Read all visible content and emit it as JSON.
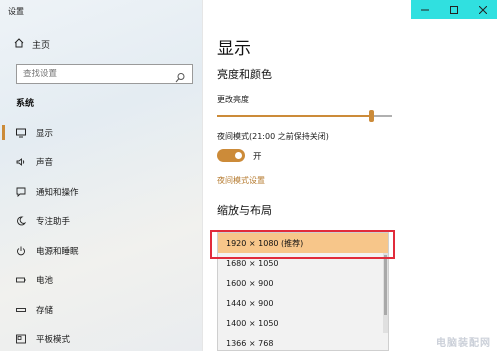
{
  "app": {
    "title": "设置"
  },
  "sidebar": {
    "home_label": "主页",
    "search_placeholder": "查找设置",
    "section_label": "系统",
    "items": [
      {
        "label": "显示",
        "icon": "monitor-icon",
        "active": true
      },
      {
        "label": "声音",
        "icon": "speaker-icon"
      },
      {
        "label": "通知和操作",
        "icon": "message-icon"
      },
      {
        "label": "专注助手",
        "icon": "moon-icon"
      },
      {
        "label": "电源和睡眠",
        "icon": "power-icon"
      },
      {
        "label": "电池",
        "icon": "battery-icon"
      },
      {
        "label": "存储",
        "icon": "storage-icon"
      },
      {
        "label": "平板模式",
        "icon": "tablet-icon"
      }
    ]
  },
  "window_controls": {
    "minimize": "—",
    "maximize": "☐",
    "close": "✕"
  },
  "main": {
    "title": "显示",
    "brightness_section": "亮度和颜色",
    "brightness_label": "更改亮度",
    "brightness_value": 88,
    "night_mode_label": "夜间模式(21:00 之前保持关闭)",
    "night_mode_state": "开",
    "night_mode_link": "夜间模式设置",
    "scale_section": "缩放与布局",
    "resolution_options": [
      {
        "label": "1920 × 1080 (推荐)",
        "selected": true
      },
      {
        "label": "1680 × 1050"
      },
      {
        "label": "1600 × 900"
      },
      {
        "label": "1440 × 900"
      },
      {
        "label": "1400 × 1050"
      },
      {
        "label": "1366 × 768"
      }
    ]
  },
  "colors": {
    "accent": "#cc8b39",
    "selected_bg": "#f7c68a",
    "highlight_border": "#e12b3b",
    "titlebar": "#30e0e0"
  },
  "watermark": "电脑装配网"
}
